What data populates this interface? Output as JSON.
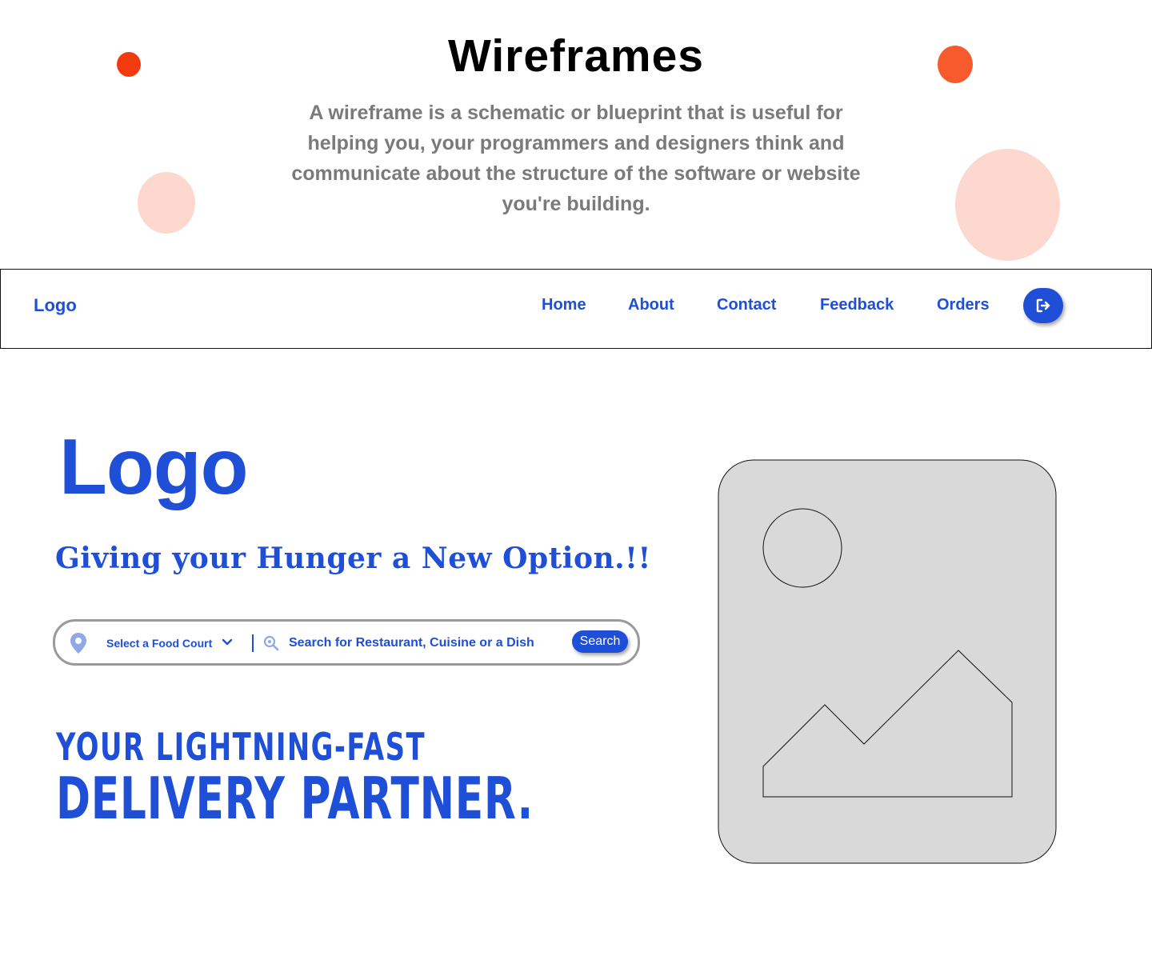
{
  "header": {
    "title": "Wireframes",
    "description": "A wireframe is a schematic or blueprint that is useful for helping you, your programmers and designers think and communicate about the structure of the software or website you're building."
  },
  "navbar": {
    "logo": "Logo",
    "links": [
      "Home",
      "About",
      "Contact",
      "Feedback",
      "Orders"
    ],
    "logout_icon": "logout-icon"
  },
  "hero": {
    "logo": "Logo",
    "tagline": "Giving your Hunger a New Option.!!"
  },
  "search": {
    "location_icon": "map-pin-icon",
    "food_court_label": "Select a Food Court",
    "search_icon": "magnifier-icon",
    "placeholder": "Search for Restaurant, Cuisine or a Dish",
    "button_label": "Search"
  },
  "slogan": {
    "line1": "YOUR LIGHTNING-FAST",
    "line2": "DELIVERY PARTNER."
  },
  "image": {
    "icon": "image-placeholder-icon"
  },
  "colors": {
    "brand": "#1f4fd6",
    "accent_dark": "#f23c0f",
    "accent": "#f65a2d",
    "accent_light": "#fcd8cf",
    "placeholder_fill": "#d9d9d9",
    "muted_text": "#7a7a7a"
  }
}
